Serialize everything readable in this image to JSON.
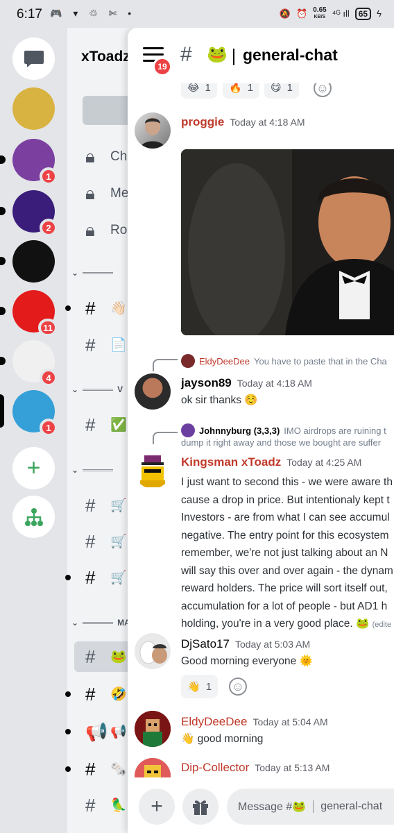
{
  "status_bar": {
    "time": "6:17",
    "left_icons": "🎮 ▾ ♲ ✄ •",
    "speed_value": "0.65",
    "speed_unit": "KB/S",
    "signal": "⁴ᴳ ıll",
    "battery": "65"
  },
  "servers": [
    {
      "name": "paw-server",
      "badge": "",
      "selected": false,
      "bg": "#d9b341"
    },
    {
      "name": "avatar-server",
      "badge": "1",
      "selected": false,
      "bg": "#7b3fa0"
    },
    {
      "name": "x-server",
      "badge": "2",
      "selected": false,
      "bg": "#3a1d7a"
    },
    {
      "name": "gzx-server",
      "badge": "",
      "selected": false,
      "bg": "#111111"
    },
    {
      "name": "v-server",
      "badge": "11",
      "selected": false,
      "bg": "#e31b1b"
    },
    {
      "name": "wsb-server",
      "badge": "4",
      "selected": false,
      "bg": "#f0f0f0"
    },
    {
      "name": "xtoadz-server",
      "badge": "1",
      "selected": true,
      "bg": "#35a0d8"
    }
  ],
  "channel_list": {
    "server_name": "xToadz",
    "items": [
      {
        "label": "Cha",
        "icon": "lock"
      },
      {
        "label": "Me",
        "icon": "lock"
      },
      {
        "label": "Rol",
        "icon": "lock"
      }
    ],
    "channels": [
      {
        "emoji": "👋🏻"
      },
      {
        "emoji": "📄"
      },
      {
        "emoji": "✅"
      },
      {
        "emoji": "🛒"
      },
      {
        "emoji": "🛒"
      },
      {
        "emoji": "🛒"
      },
      {
        "emoji": "🐸"
      },
      {
        "emoji": "🤣"
      },
      {
        "emoji": "📢"
      },
      {
        "emoji": "🗞️"
      },
      {
        "emoji": "🦜"
      }
    ],
    "categories": [
      "V",
      "MA"
    ]
  },
  "chat": {
    "menu_badge": "19",
    "channel_emoji": "🐸",
    "channel_name": "general-chat",
    "top_reactions": [
      {
        "emoji": "😂",
        "count": "1"
      },
      {
        "emoji": "🔥",
        "count": "1"
      },
      {
        "emoji": "😋",
        "count": "1"
      }
    ],
    "messages": {
      "proggie": {
        "name": "proggie",
        "time": "Today at 4:18 AM"
      },
      "jayson": {
        "reply_name": "EldyDeeDee",
        "reply_text": "You have to paste that in the Cha",
        "name": "jayson89",
        "time": "Today at 4:18 AM",
        "text": "ok sir thanks ☺️"
      },
      "kingsman": {
        "reply_name": "Johnnyburg (3,3,3)",
        "reply_text_1": "IMO airdrops are ruining t",
        "reply_text_2": "dump it right away and those we bought are suffer",
        "name": "Kingsman xToadz",
        "time": "Today at 4:25 AM",
        "lines": [
          "I just want to second this - we were aware th",
          "cause a drop in price. But intentionaly kept t",
          "Investors - are from what I can see accumul",
          "negative. The entry point for this ecosystem",
          "remember, we're not just talking about an N",
          "will say this over and over again - the dynam",
          "reward holders. The price will sort itself out,",
          "accumulation for a lot of people - but AD1 h",
          "holding, you're in a very good place. 🐸"
        ],
        "edited": "(edite"
      },
      "djsato": {
        "name": "DjSato17",
        "time": "Today at 5:03 AM",
        "text": "Good morning everyone 🌞",
        "reaction_emoji": "👋",
        "reaction_count": "1"
      },
      "eldy": {
        "name": "EldyDeeDee",
        "time": "Today at 5:04 AM",
        "text": "👋 good morning"
      },
      "dip": {
        "name": "Dip-Collector",
        "time": "Today at 5:13 AM"
      }
    },
    "composer": {
      "placeholder_prefix": "Message #🐸",
      "placeholder_channel": "general-chat"
    }
  },
  "colors": {
    "mention_red": "#c0392b",
    "badge_red": "#ed4245",
    "rail_bg": "#e3e5e8"
  }
}
